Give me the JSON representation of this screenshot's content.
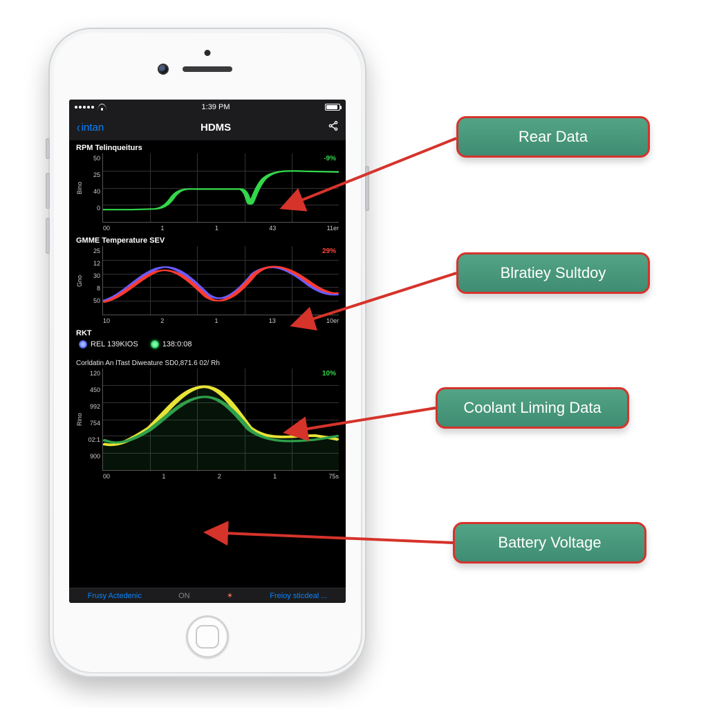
{
  "status_bar": {
    "time": "1:39 PM"
  },
  "nav": {
    "back_label": "intan",
    "title": "HDMS"
  },
  "callouts": {
    "c1": "Rear Data",
    "c2": "Blratiey Sultdoy",
    "c3": "Coolant Liming Data",
    "c4": "Battery Voltage"
  },
  "panel1": {
    "title": "RPM Telinqueiturs",
    "badge": "-9%",
    "yaxis": "Bino",
    "yticks": [
      "50",
      "25",
      "40",
      "0"
    ],
    "xticks": [
      "00",
      "1",
      "1",
      "43",
      "11er"
    ]
  },
  "panel2": {
    "title": "GMME Temperature SEV",
    "badge": "29%",
    "yaxis": "Gno",
    "yticks": [
      "25",
      "12",
      "30",
      "8",
      "50"
    ],
    "xticks": [
      "10",
      "2",
      "1",
      "13",
      "10er"
    ]
  },
  "rkt": {
    "title": "RKT",
    "rel_label": "REL 139KIOS",
    "val_label": "138:0:08"
  },
  "panel3": {
    "subtitle": "Corldatin An lTast Diweature  SD0,871.6  02/ Rh",
    "badge": "10%",
    "yaxis": "Rino",
    "yticks": [
      "120",
      "450",
      "992",
      "754",
      "02:1",
      "900"
    ],
    "xticks": [
      "00",
      "1",
      "2",
      "1",
      "75s"
    ]
  },
  "tabs": {
    "t1": "Frusy Actedenic",
    "sep": "ON",
    "t2": "Freioy sticdeal ..."
  },
  "chart_data": [
    {
      "type": "line",
      "title": "RPM Telinqueiturs",
      "xlabel": "",
      "ylabel": "Bino",
      "annotation_pct": "-9%",
      "x_ticks": [
        "00",
        "1",
        "1",
        "43",
        "11er"
      ],
      "y_ticks": [
        0,
        40,
        25,
        50
      ],
      "series": [
        {
          "name": "rpm",
          "color": "#32d74b",
          "x": [
            0.0,
            0.12,
            0.22,
            0.3,
            0.38,
            0.46,
            0.58,
            0.62,
            0.66,
            0.74,
            0.86,
            1.0
          ],
          "y_norm": [
            0.18,
            0.18,
            0.19,
            0.3,
            0.46,
            0.48,
            0.48,
            0.22,
            0.55,
            0.76,
            0.74,
            0.73
          ]
        }
      ]
    },
    {
      "type": "line",
      "title": "GMME Temperature SEV",
      "xlabel": "",
      "ylabel": "Gno",
      "annotation_pct": "29%",
      "x_ticks": [
        "10",
        "2",
        "1",
        "13",
        "10er"
      ],
      "y_ticks": [
        50,
        8,
        30,
        12,
        25
      ],
      "series": [
        {
          "name": "series-blue",
          "color": "#6b5bff",
          "x": [
            0.0,
            0.1,
            0.2,
            0.3,
            0.4,
            0.5,
            0.6,
            0.7,
            0.8,
            0.9,
            1.0
          ],
          "y_norm": [
            0.2,
            0.28,
            0.6,
            0.72,
            0.45,
            0.22,
            0.3,
            0.64,
            0.74,
            0.5,
            0.3
          ]
        },
        {
          "name": "series-red",
          "color": "#ff3b30",
          "x": [
            0.0,
            0.1,
            0.2,
            0.3,
            0.4,
            0.5,
            0.6,
            0.7,
            0.8,
            0.9,
            1.0
          ],
          "y_norm": [
            0.18,
            0.26,
            0.56,
            0.66,
            0.42,
            0.2,
            0.28,
            0.6,
            0.78,
            0.55,
            0.32
          ]
        }
      ]
    },
    {
      "type": "line",
      "title": "Corldatin An lTast Diweature SD0,871.6 02/ Rh",
      "xlabel": "",
      "ylabel": "Rino",
      "annotation_pct": "10%",
      "x_ticks": [
        "00",
        "1",
        "2",
        "1",
        "75s"
      ],
      "y_ticks": [
        "900",
        "02:1",
        "754",
        "992",
        "450",
        "120"
      ],
      "series": [
        {
          "name": "yellow",
          "color": "#e8e337",
          "x": [
            0.0,
            0.1,
            0.2,
            0.28,
            0.36,
            0.44,
            0.52,
            0.6,
            0.72,
            0.86,
            1.0
          ],
          "y_norm": [
            0.26,
            0.22,
            0.3,
            0.52,
            0.8,
            0.82,
            0.62,
            0.4,
            0.3,
            0.34,
            0.3
          ]
        },
        {
          "name": "green",
          "color": "#2fa04a",
          "x": [
            0.0,
            0.1,
            0.2,
            0.28,
            0.36,
            0.44,
            0.52,
            0.6,
            0.72,
            0.86,
            1.0
          ],
          "y_norm": [
            0.3,
            0.24,
            0.28,
            0.44,
            0.66,
            0.7,
            0.58,
            0.4,
            0.28,
            0.26,
            0.34
          ]
        }
      ]
    }
  ]
}
